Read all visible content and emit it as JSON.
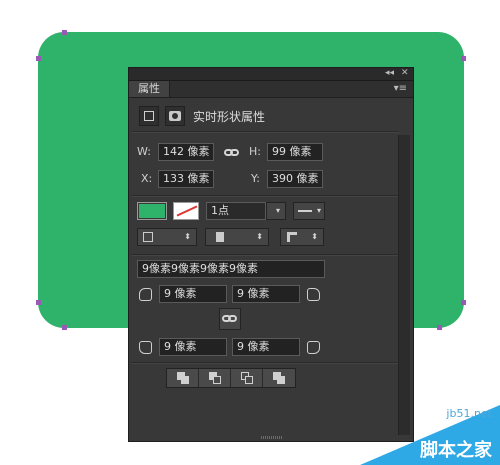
{
  "panel": {
    "collapse_glyph": "◂◂",
    "close_glyph": "✕",
    "tab_label": "属性",
    "menu_glyph": "▾≡",
    "section_title": "实时形状属性"
  },
  "dimensions": {
    "w_label": "W:",
    "w_value": "142 像素",
    "h_label": "H:",
    "h_value": "99 像素",
    "x_label": "X:",
    "x_value": "133 像素",
    "y_label": "Y:",
    "y_value": "390 像素"
  },
  "appearance": {
    "fill_color": "#2fb26a",
    "stroke_width_value": "1点",
    "dropdown_arrow": "▾"
  },
  "corners": {
    "combined_value": "9像素9像素9像素9像素",
    "top_left": "9 像素",
    "top_right": "9 像素",
    "bottom_left": "9 像素",
    "bottom_right": "9 像素"
  },
  "watermark": {
    "site": "jb51.net",
    "name": "脚本之家"
  },
  "colors": {
    "shape": "#2fb26a",
    "anchor": "#9b59b6",
    "panel_bg": "#383838"
  }
}
